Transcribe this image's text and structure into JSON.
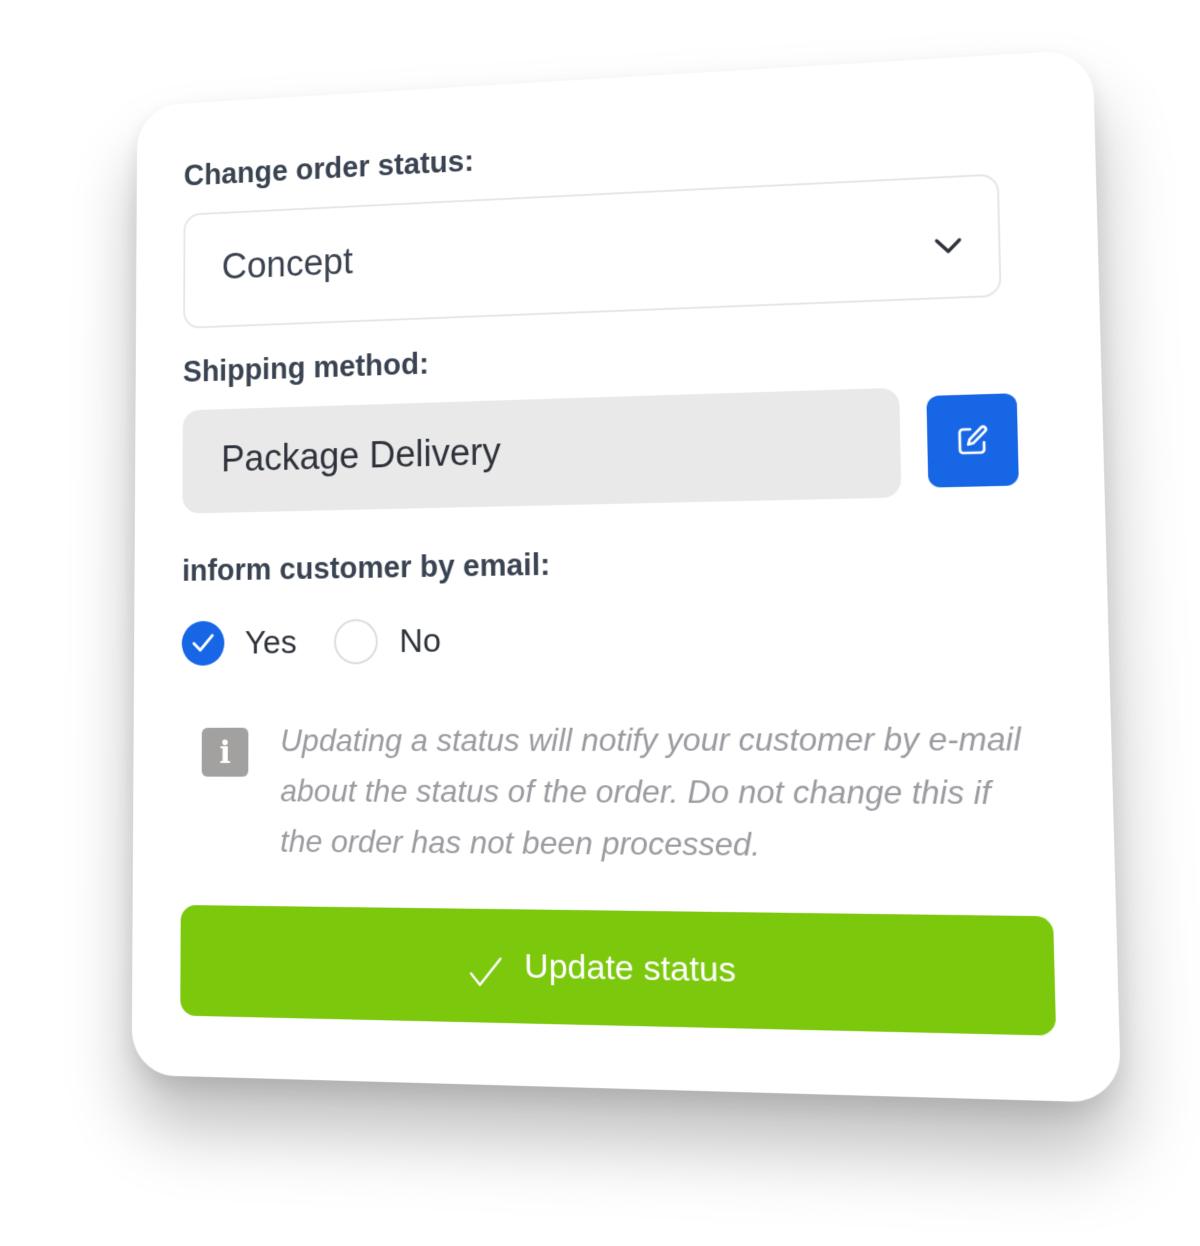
{
  "form": {
    "status_label": "Change order status:",
    "status_value": "Concept",
    "shipping_label": "Shipping method:",
    "shipping_value": "Package Delivery",
    "inform_label": "inform customer by email:",
    "radio_yes": "Yes",
    "radio_no": "No",
    "info_text": "Updating a status will notify your customer by e-mail about the status of the order. Do not change this if the order has not been processed.",
    "update_button": "Update status"
  },
  "selected_option": "Yes",
  "icons": {
    "dropdown": "chevron-down-icon",
    "edit": "edit-icon",
    "checked": "checkmark-icon",
    "info": "info-icon",
    "submit": "checkmark-icon"
  },
  "colors": {
    "primary_blue": "#1666e6",
    "success_green": "#7bc80d",
    "label_text": "#3a4351",
    "muted_text": "#9c9aa0",
    "field_bg": "#e9e9e9"
  }
}
